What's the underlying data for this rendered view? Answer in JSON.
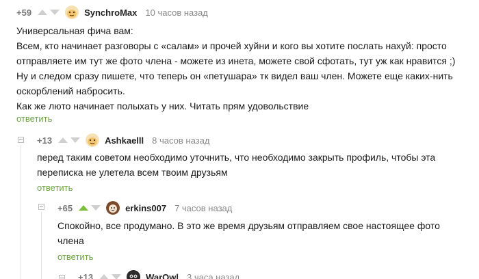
{
  "comments": [
    {
      "rating": "+59",
      "username": "SynchroMax",
      "time": "10 часов назад",
      "avatar": "synchromax-avatar",
      "lines": [
        "Универсальная фича вам:",
        "Всем, кто начинает разговоры с «салам» и прочей хуйни и кого вы хотите послать нахуй: просто",
        "отправляете им тут же фото члена - можете из инета, можете свой сфотать, тут уж как нравится ;)",
        "Ну и следом сразу пишете, что теперь он «петушара» тк видел ваш член. Можете еще каких-нить",
        "оскорблений набросить.",
        "Как же люто начинает полыхать у них. Читать прям удовольствие"
      ],
      "reply_label": "ответить"
    },
    {
      "rating": "+13",
      "username": "Ashkaelll",
      "time": "8 часов назад",
      "avatar": "ashkaelll-avatar",
      "lines": [
        "перед таким советом необходимо уточнить, что необходимо закрыть профиль, чтобы эта",
        "переписка не улетела всем твоим друзьям"
      ],
      "reply_label": "ответить"
    },
    {
      "rating": "+65",
      "username": "erkins007",
      "time": "7 часов назад",
      "avatar": "erkins007-avatar",
      "lines": [
        "Спокойно, все продумано. В это же время друзьям отправляем свое настоящее фото",
        "члена"
      ],
      "reply_label": "ответить"
    },
    {
      "rating": "+13",
      "username": "WarOwl",
      "time": "3 часа назад",
      "avatar": "warowl-avatar",
      "lines": [],
      "reply_label": ""
    }
  ],
  "colors": {
    "accent_green": "#6ba543",
    "upvote_active": "#7cbe3c",
    "muted": "#888888"
  }
}
